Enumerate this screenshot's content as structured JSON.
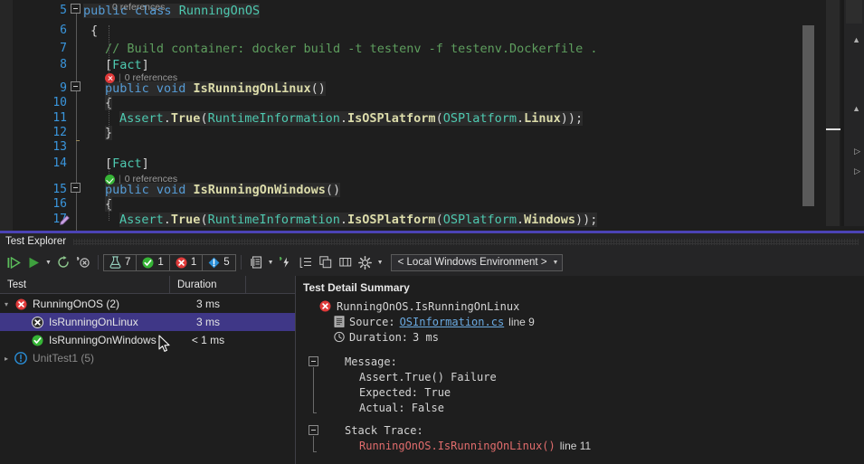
{
  "editor": {
    "first_line": 5,
    "lines": [
      {
        "num": 5,
        "indent": 0,
        "tokens": [
          [
            "kw",
            "public "
          ],
          [
            "kw",
            "class "
          ],
          [
            "type",
            "RunningOnOS"
          ]
        ]
      },
      {
        "num": 6,
        "indent": 8,
        "tokens": [
          [
            "plain",
            "{"
          ]
        ]
      },
      {
        "num": 7,
        "indent": 24,
        "tokens": [
          [
            "cmt",
            "// Build container: docker build -t testenv -f testenv.Dockerfile ."
          ]
        ]
      },
      {
        "num": 8,
        "indent": 24,
        "tokens": [
          [
            "punct",
            "["
          ],
          [
            "attr",
            "Fact"
          ],
          [
            "punct",
            "]"
          ]
        ]
      },
      {
        "num": 9,
        "indent": 24,
        "tokens": [
          [
            "kw",
            "public "
          ],
          [
            "kw",
            "void "
          ],
          [
            "meth",
            "IsRunningOnLinux"
          ],
          [
            "plain",
            "()"
          ]
        ]
      },
      {
        "num": 10,
        "indent": 24,
        "tokens": [
          [
            "plain",
            "{"
          ]
        ]
      },
      {
        "num": 11,
        "indent": 40,
        "tokens": [
          [
            "type",
            "Assert"
          ],
          [
            "punct",
            "."
          ],
          [
            "meth",
            "True"
          ],
          [
            "punct",
            "("
          ],
          [
            "type",
            "RuntimeInformation"
          ],
          [
            "punct",
            "."
          ],
          [
            "meth",
            "IsOSPlatform"
          ],
          [
            "punct",
            "("
          ],
          [
            "type",
            "OSPlatform"
          ],
          [
            "punct",
            "."
          ],
          [
            "meth",
            "Linux"
          ],
          [
            "punct",
            "));"
          ]
        ]
      },
      {
        "num": 12,
        "indent": 24,
        "tokens": [
          [
            "plain",
            "}"
          ]
        ]
      },
      {
        "num": 13,
        "indent": 0,
        "tokens": []
      },
      {
        "num": 14,
        "indent": 24,
        "tokens": [
          [
            "punct",
            "["
          ],
          [
            "attr",
            "Fact"
          ],
          [
            "punct",
            "]"
          ]
        ]
      },
      {
        "num": 15,
        "indent": 24,
        "tokens": [
          [
            "kw",
            "public "
          ],
          [
            "kw",
            "void "
          ],
          [
            "meth",
            "IsRunningOnWindows"
          ],
          [
            "plain",
            "()"
          ]
        ]
      },
      {
        "num": 16,
        "indent": 24,
        "tokens": [
          [
            "plain",
            "{"
          ]
        ]
      },
      {
        "num": 17,
        "indent": 40,
        "tokens": [
          [
            "type",
            "Assert"
          ],
          [
            "punct",
            "."
          ],
          [
            "meth",
            "True"
          ],
          [
            "punct",
            "("
          ],
          [
            "type",
            "RuntimeInformation"
          ],
          [
            "punct",
            "."
          ],
          [
            "meth",
            "IsOSPlatform"
          ],
          [
            "punct",
            "("
          ],
          [
            "type",
            "OSPlatform"
          ],
          [
            "punct",
            "."
          ],
          [
            "meth",
            "Windows"
          ],
          [
            "punct",
            "));"
          ]
        ]
      }
    ],
    "codelens": [
      {
        "text": "0 references",
        "status": "none"
      },
      {
        "text": "0 references",
        "status": "error"
      },
      {
        "text": "0 references",
        "status": "ok"
      }
    ]
  },
  "test_explorer": {
    "title": "Test Explorer",
    "toolbar": {
      "run_all_label": "Run All Tests",
      "run_label": "Run",
      "run_caret_label": "Run dropdown",
      "repeat_label": "Repeat Last Run",
      "cancel_label": "Cancel",
      "counts": [
        {
          "icon": "flask-icon",
          "value": "7",
          "color": "#9ad7c4"
        },
        {
          "icon": "passed-icon",
          "value": "1",
          "color": "#36b436"
        },
        {
          "icon": "failed-icon",
          "value": "1",
          "color": "#e03a3a"
        },
        {
          "icon": "notrun-icon",
          "value": "5",
          "color": "#2a8fd8"
        }
      ],
      "playlist_label": "Playlist",
      "playlist_caret_label": "Playlist dropdown",
      "coverage_label": "Analyze Code Coverage",
      "grouping_label": "Group By",
      "copy_label": "Copy",
      "columns_label": "Columns",
      "settings_label": "Settings",
      "settings_caret_label": "Settings dropdown",
      "environment": "< Local Windows Environment >"
    },
    "columns": {
      "test": "Test",
      "duration": "Duration",
      "extra": ""
    },
    "rows": [
      {
        "level": 0,
        "expander": "collapse",
        "status": "failed",
        "name": "RunningOnOS (2)",
        "duration": "3 ms",
        "selected": false,
        "dim": false
      },
      {
        "level": 1,
        "expander": "none",
        "status": "failed",
        "name": "IsRunningOnLinux",
        "duration": "3 ms",
        "selected": true,
        "dim": false
      },
      {
        "level": 1,
        "expander": "none",
        "status": "passed",
        "name": "IsRunningOnWindows",
        "duration": "< 1 ms",
        "selected": false,
        "dim": false
      },
      {
        "level": 0,
        "expander": "expand",
        "status": "notrun",
        "name": "UnitTest1 (5)",
        "duration": "",
        "selected": false,
        "dim": true
      }
    ],
    "detail": {
      "title": "Test Detail Summary",
      "test_name": "RunningOnOS.IsRunningOnLinux",
      "source_label": "Source:",
      "source_file": "OSInformation.cs",
      "source_line": "line 9",
      "duration_label": "Duration:",
      "duration_value": "3 ms",
      "message_label": "Message:",
      "message_lines": [
        "Assert.True() Failure",
        "Expected: True",
        "Actual:   False"
      ],
      "stack_label": "Stack Trace:",
      "stack_frame": "RunningOnOS.IsRunningOnLinux()",
      "stack_line": "line 11"
    }
  },
  "colors": {
    "accent_selection": "#3f3787",
    "splitter": "#4b43b5",
    "editor_bg": "#1e1e1e",
    "panel_bg": "#252526",
    "failed": "#e03a3a",
    "passed": "#36b436",
    "notrun": "#2a8fd8",
    "link": "#6aa9e0"
  }
}
